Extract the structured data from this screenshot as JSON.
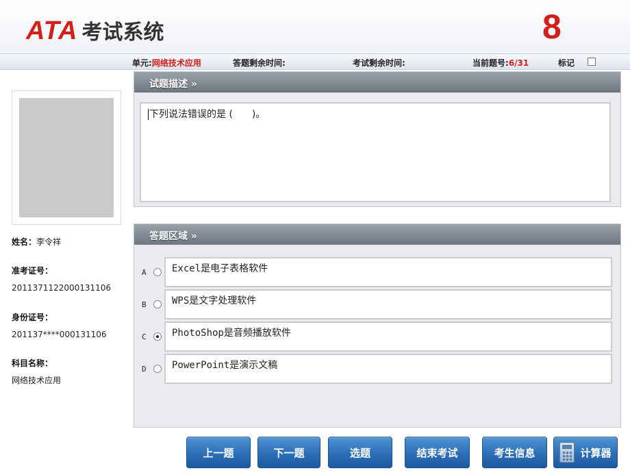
{
  "header": {
    "logo_brand": "ATA",
    "logo_text": "考试系统",
    "big_number": "8"
  },
  "infobar": {
    "unit_label": "单元:",
    "unit_value": "网络技术应用",
    "answer_time_label": "答题剩余时间:",
    "exam_time_label": "考试剩余时间:",
    "current_q_label": "当前题号:",
    "current_q_value": "6/31",
    "mark_label": "标记"
  },
  "candidate": {
    "name_label": "姓名：",
    "name_value": "李令祥",
    "admission_label": "准考证号：",
    "admission_value": "201137112200013110​6",
    "id_label": "身份证号：",
    "id_value": "201137****000131106",
    "subject_label": "科目名称：",
    "subject_value": "网络技术应用"
  },
  "question": {
    "title": "试题描述 »",
    "text": "下列说法错误的是 (　　)。"
  },
  "answer": {
    "title": "答题区域 »",
    "options": [
      {
        "letter": "A",
        "text": "Excel是电子表格软件",
        "selected": false
      },
      {
        "letter": "B",
        "text": "WPS是文字处理软件",
        "selected": false
      },
      {
        "letter": "C",
        "text": "PhotoShop是音频播放软件",
        "selected": true
      },
      {
        "letter": "D",
        "text": "PowerPoint是演示文稿",
        "selected": false
      }
    ]
  },
  "buttons": {
    "prev": "上一题",
    "next": "下一题",
    "select": "选题",
    "finish": "结束考试",
    "info": "考生信息",
    "calc": "计算器"
  },
  "colors": {
    "brand_red": "#d3201b",
    "button_blue": "#2c6fb7",
    "panel_header": "#7a838c"
  }
}
